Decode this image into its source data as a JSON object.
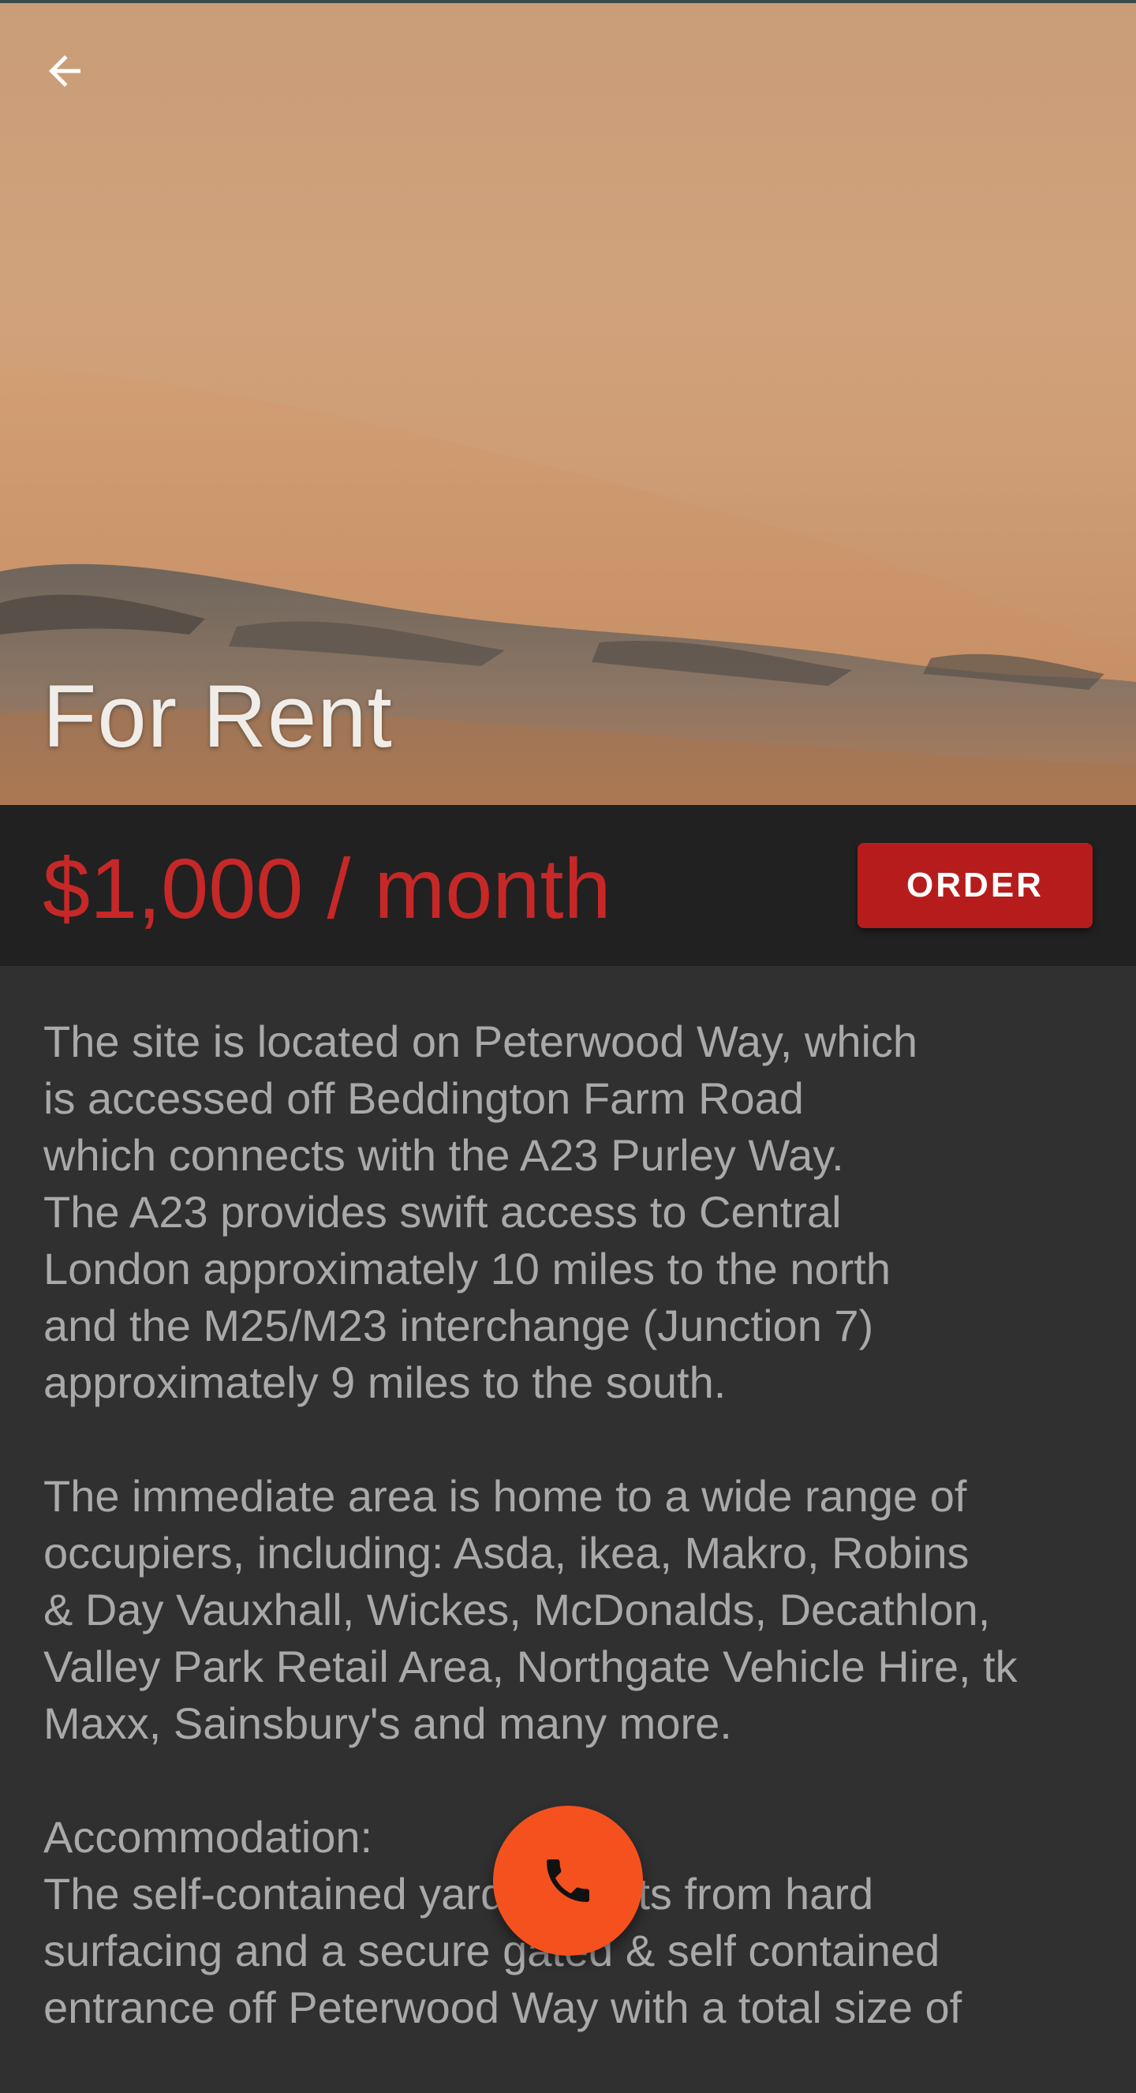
{
  "header": {
    "back_icon": "arrow-back-icon",
    "title": "For Rent"
  },
  "listing": {
    "price": "$1,000 / month",
    "order_label": "ORDER",
    "description_paragraphs": [
      "The site is located on Peterwood Way, which\nis accessed off Beddington Farm Road\nwhich connects with the A23 Purley Way.\nThe A23 provides swift access to Central\nLondon approximately 10 miles to the north\nand the M25/M23 interchange (Junction 7)\napproximately 9 miles to the south.",
      "The immediate area is home to a wide range of\noccupiers, including: Asda, ikea, Makro, Robins\n& Day Vauxhall, Wickes, McDonalds, Decathlon,\nValley Park Retail Area, Northgate Vehicle Hire, tk\nMaxx, Sainsbury's and many more.",
      "Accommodation:\nThe self-contained yard benefits from hard\nsurfacing and a secure gated & self contained\nentrance off Peterwood Way with a total size of"
    ]
  },
  "fab": {
    "icon": "phone-icon"
  },
  "colors": {
    "price": "#c62828",
    "order_button": "#b71c1c",
    "fab": "#f4511e",
    "price_bar_bg": "#212121",
    "content_bg": "#303030"
  }
}
